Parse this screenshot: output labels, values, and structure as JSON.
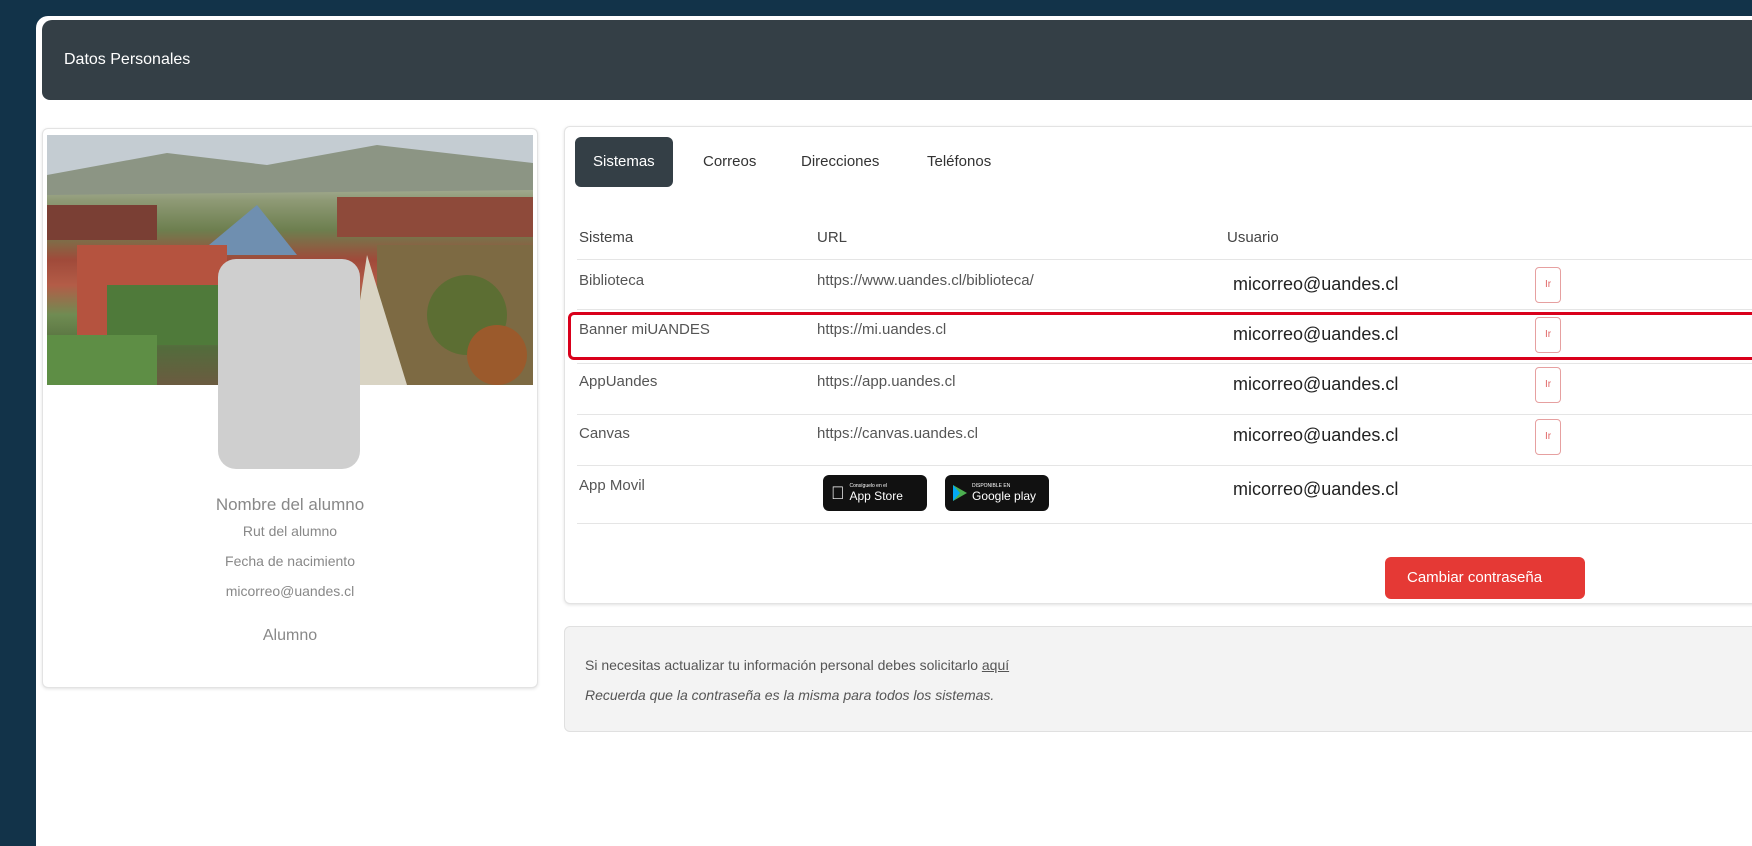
{
  "header": {
    "title": "Datos Personales"
  },
  "profile": {
    "name": "Nombre del alumno",
    "rut": "Rut del alumno",
    "birthdate": "Fecha de nacimiento",
    "email": "micorreo@uandes.cl",
    "role": "Alumno"
  },
  "tabs": [
    "Sistemas",
    "Correos",
    "Direcciones",
    "Teléfonos"
  ],
  "table": {
    "headers": [
      "Sistema",
      "URL",
      "Usuario"
    ],
    "rows": [
      {
        "system": "Biblioteca",
        "url": "https://www.uandes.cl/biblioteca/",
        "user": "micorreo@uandes.cl",
        "action": "Ir"
      },
      {
        "system": "Banner miUANDES",
        "url": "https://mi.uandes.cl",
        "user": "micorreo@uandes.cl",
        "action": "Ir"
      },
      {
        "system": "AppUandes",
        "url": "https://app.uandes.cl",
        "user": "micorreo@uandes.cl",
        "action": "Ir"
      },
      {
        "system": "Canvas",
        "url": "https://canvas.uandes.cl",
        "user": "micorreo@uandes.cl",
        "action": "Ir"
      },
      {
        "system": "App Movil",
        "url": "",
        "user": "micorreo@uandes.cl",
        "action": ""
      }
    ]
  },
  "badges": {
    "appstore_small": "Consíguelo en el",
    "appstore_big": "App Store",
    "googleplay_small": "DISPONIBLE EN",
    "googleplay_big": "Google play"
  },
  "change_password_label": "Cambiar contraseña",
  "note": {
    "line1": "Si necesitas actualizar tu información personal debes solicitarlo ",
    "link": "aquí",
    "line2": "Recuerda que la contraseña es la misma para todos los sistemas."
  },
  "colors": {
    "background": "#123349",
    "header": "#343f46",
    "danger": "#e53935",
    "highlight": "#d9001b"
  }
}
